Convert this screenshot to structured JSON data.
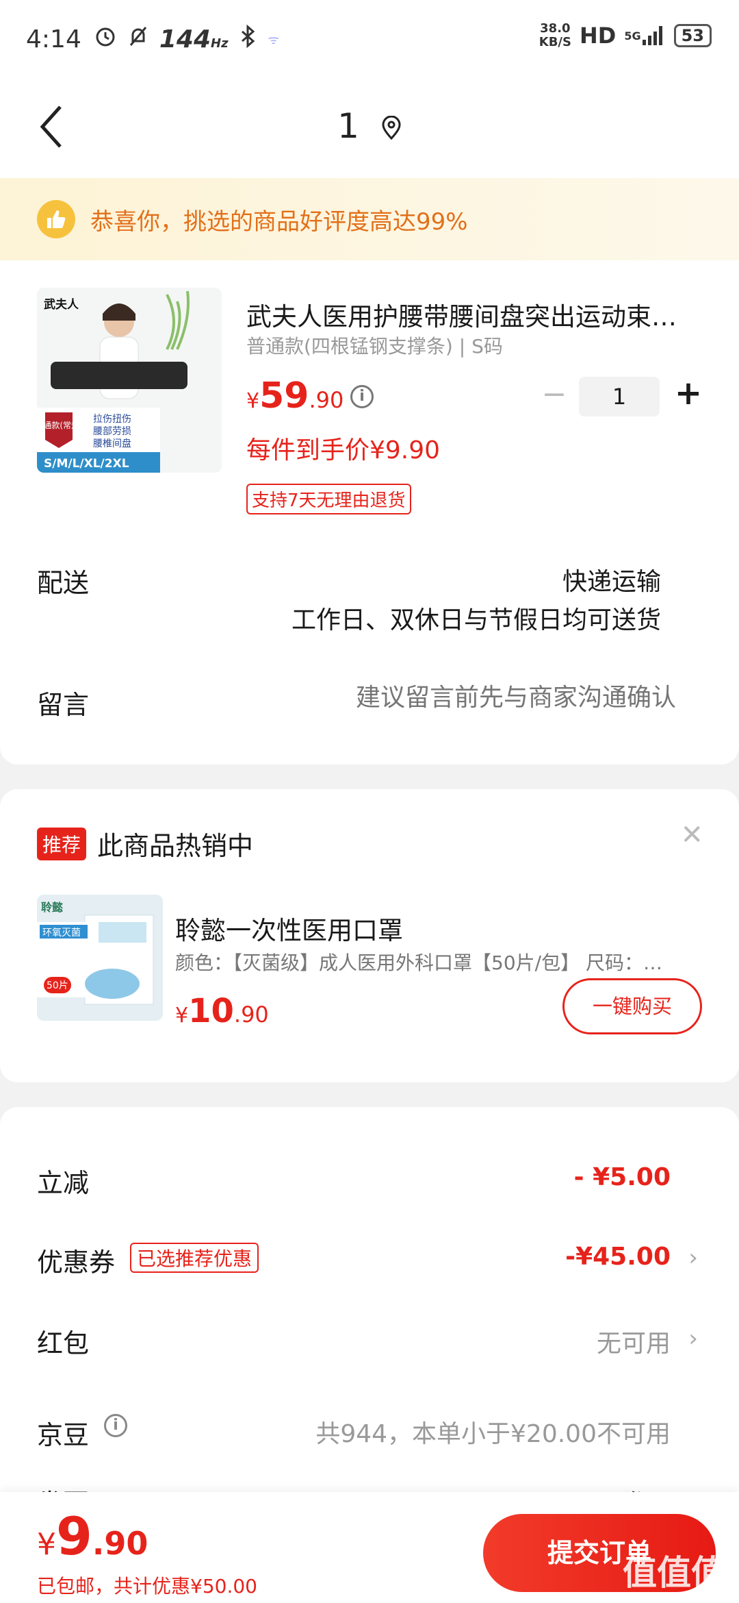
{
  "status": {
    "time": "4:14",
    "refresh": "144",
    "refresh_unit": "Hz",
    "net_speed_value": "38.0",
    "net_speed_unit": "KB/S",
    "hd": "HD",
    "net_type": "5G",
    "battery": "53"
  },
  "nav": {
    "title": "1"
  },
  "banner": {
    "text": "恭喜你，挑选的商品好评度高达99%"
  },
  "product": {
    "title": "武夫人医用护腰带腰间盘突出运动束…",
    "spec": "普通款(四根锰钢支撑条) | S码",
    "price_symbol": "¥",
    "price_int": "59",
    "price_dec": ".90",
    "quantity": "1",
    "unit_price": "每件到手价¥9.90",
    "return_policy": "支持7天无理由退货",
    "image_brand": "武夫人",
    "image_badge": "普通款(常规)",
    "image_features": [
      "拉伤扭伤",
      "腰部劳损",
      "腰椎间盘"
    ],
    "image_sizes": "S/M/L/XL/2XL"
  },
  "delivery": {
    "label": "配送",
    "method": "快递运输",
    "schedule": "工作日、双休日与节假日均可送货"
  },
  "note": {
    "label": "留言",
    "placeholder": "建议留言前先与商家沟通确认"
  },
  "recommend": {
    "tag": "推荐",
    "title": "此商品热销中",
    "name": "聆懿一次性医用口罩",
    "spec": "颜色：【灭菌级】成人医用外科口罩【50片/包】  尺码：…",
    "price_symbol": "¥",
    "price_int": "10",
    "price_dec": ".90",
    "buy_label": "一键购买",
    "image_text_1": "环氧灭菌",
    "image_text_2": "50片",
    "image_brand": "聆懿"
  },
  "costs": {
    "discount_label": "立减",
    "discount_value": "- ¥5.00",
    "coupon_label": "优惠券",
    "coupon_tag": "已选推荐优惠",
    "coupon_value": "-¥45.00",
    "redpacket_label": "红包",
    "redpacket_value": "无可用",
    "jd_label": "京豆",
    "jd_value": "共944，本单小于¥20.00不可用",
    "invoice_label": "发票",
    "invoice_value": "不开发票"
  },
  "bottom": {
    "price_symbol": "¥",
    "price_int": "9",
    "price_dec": ".90",
    "subtitle": "已包邮，共计优惠¥50.00",
    "submit_label": "提交订单",
    "watermark": "值值值"
  },
  "colors": {
    "accent_red": "#e6231b",
    "banner_orange": "#e2701a"
  }
}
